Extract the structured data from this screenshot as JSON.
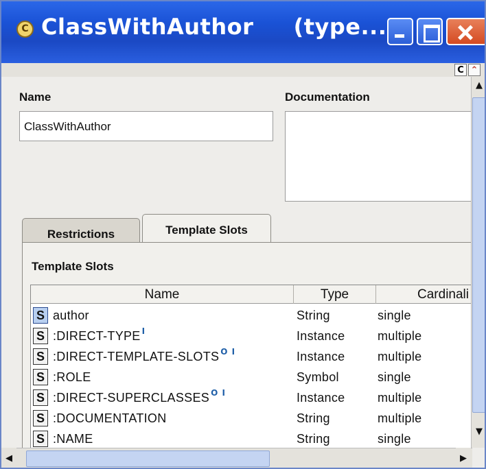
{
  "window": {
    "title": "ClassWithAuthor     (type...",
    "class_icon_letter": "C",
    "controls": [
      "minimize",
      "maximize",
      "close"
    ]
  },
  "toolstrip": {
    "buttons": [
      "C",
      "⌃"
    ]
  },
  "form": {
    "name_label": "Name",
    "name_value": "ClassWithAuthor",
    "documentation_label": "Documentation",
    "documentation_value": ""
  },
  "tabs": [
    {
      "label": "Restrictions",
      "selected": false
    },
    {
      "label": "Template Slots",
      "selected": true
    }
  ],
  "panel": {
    "heading": "Template Slots"
  },
  "table": {
    "columns": [
      "Name",
      "Type",
      "Cardinali"
    ],
    "rows": [
      {
        "icon": "S",
        "name": "author",
        "marks": "",
        "type": "String",
        "cardinality": "single"
      },
      {
        "icon": "S",
        "name": ":DIRECT-TYPE",
        "marks": "I",
        "type": "Instance",
        "cardinality": "multiple"
      },
      {
        "icon": "S",
        "name": ":DIRECT-TEMPLATE-SLOTS",
        "marks": "O I",
        "type": "Instance",
        "cardinality": "multiple"
      },
      {
        "icon": "S",
        "name": ":ROLE",
        "marks": "",
        "type": "Symbol",
        "cardinality": "single"
      },
      {
        "icon": "S",
        "name": ":DIRECT-SUPERCLASSES",
        "marks": "O I",
        "type": "Instance",
        "cardinality": "multiple"
      },
      {
        "icon": "S",
        "name": ":DOCUMENTATION",
        "marks": "",
        "type": "String",
        "cardinality": "multiple"
      },
      {
        "icon": "S",
        "name": ":NAME",
        "marks": "",
        "type": "String",
        "cardinality": "single"
      }
    ]
  },
  "scrollbars": {
    "up": "▲",
    "down": "▼",
    "left": "◀",
    "right": "▶"
  },
  "colors": {
    "titlebar": "#1b49c4",
    "close_button": "#d44a22",
    "scroll_thumb": "#c4d4f2",
    "window_bg": "#eeedea"
  }
}
